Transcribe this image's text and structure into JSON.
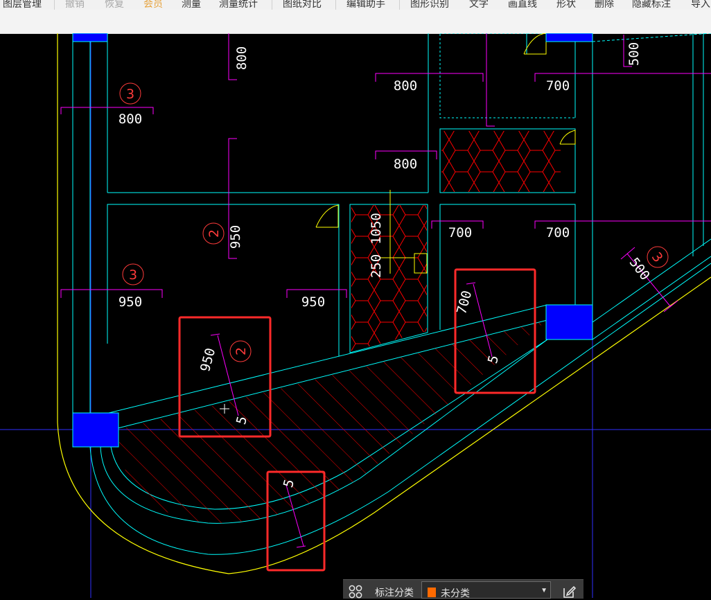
{
  "menu": {
    "items": [
      {
        "label": "图层管理",
        "state": "normal"
      },
      {
        "label": "撤销",
        "state": "disabled"
      },
      {
        "label": "恢复",
        "state": "disabled"
      },
      {
        "label": "会员",
        "state": "accent"
      },
      {
        "label": "测量",
        "state": "normal"
      },
      {
        "label": "测量统计",
        "state": "normal"
      },
      {
        "label": "图纸对比",
        "state": "normal"
      },
      {
        "label": "编辑助手",
        "state": "normal"
      },
      {
        "label": "图形识别",
        "state": "normal"
      },
      {
        "label": "文字",
        "state": "normal"
      },
      {
        "label": "画直线",
        "state": "normal"
      },
      {
        "label": "形状",
        "state": "normal"
      },
      {
        "label": "删除",
        "state": "normal"
      },
      {
        "label": "隐藏标注",
        "state": "normal"
      },
      {
        "label": "导入",
        "state": "normal"
      }
    ]
  },
  "colors": {
    "menu_text": "#333333",
    "menu_disabled": "#a8a8a8",
    "menu_accent": "#e6a23c",
    "cad_background": "#000000",
    "cyan": "#00ffff",
    "magenta": "#ff00ff",
    "yellow": "#ffff00",
    "red": "#ff0000",
    "blue_fill": "#0000ff",
    "crosshair": "#3030ff",
    "highlight_box": "#ff2a2a",
    "swatch": "#ff6a00"
  },
  "drawing": {
    "dimensions": {
      "top_vertical": "800",
      "upper_mid": "800",
      "upper_right": "700",
      "upper_left": "800",
      "mid_vertical": "950",
      "mid_center": "800",
      "far_right_vertical": "500",
      "hex_vertical_a": "1050",
      "hex_vertical_b": "250",
      "center_right": "700",
      "right": "700",
      "left": "950",
      "center": "950",
      "slant_right": "500",
      "box1": "950",
      "box2": "700",
      "box3": "5",
      "box1_s": "5",
      "box2_s": "5"
    },
    "circle_labels": {
      "upper_left": "3",
      "mid": "2",
      "lower_left": "3",
      "slant_right": "3",
      "box1": "2"
    }
  },
  "bottom_panel": {
    "label": "标注分类",
    "select_value": "未分类",
    "icons": {
      "grid": "grid-icon",
      "edit": "edit-icon",
      "dropdown": "chevron-down-icon"
    }
  }
}
